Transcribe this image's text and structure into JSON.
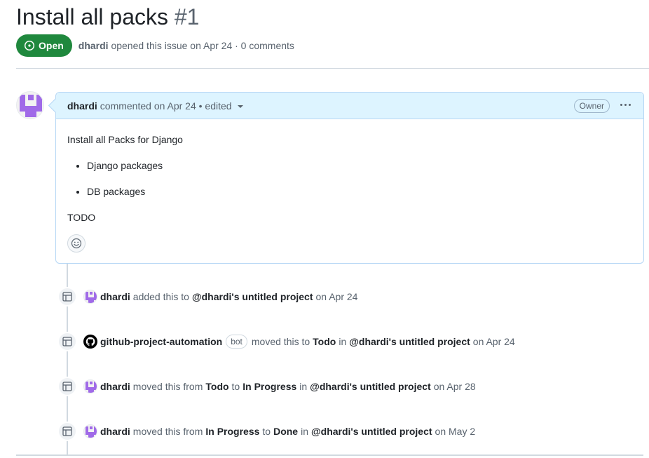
{
  "issue": {
    "title": "Install all packs",
    "number": "#1",
    "state": "Open",
    "author": "dhardi",
    "opened_text": "opened this issue on Apr 24 · 0 comments"
  },
  "comment": {
    "author": "dhardi",
    "meta": "commented on Apr 24 • edited",
    "owner_badge": "Owner",
    "intro": "Install all Packs for Django",
    "items": [
      "Django packages",
      "DB packages"
    ],
    "footer": "TODO"
  },
  "events": [
    {
      "actor": "dhardi",
      "text1": "added this to",
      "project": "@dhardi's untitled project",
      "text2": "on Apr 24"
    },
    {
      "actor": "github-project-automation",
      "bot": "bot",
      "text1": "moved this to",
      "col1": "Todo",
      "text_in": "in",
      "project": "@dhardi's untitled project",
      "text2": "on Apr 24"
    },
    {
      "actor": "dhardi",
      "text1": "moved this from",
      "col1": "Todo",
      "text_to": "to",
      "col2": "In Progress",
      "text_in": "in",
      "project": "@dhardi's untitled project",
      "text2": "on Apr 28"
    },
    {
      "actor": "dhardi",
      "text1": "moved this from",
      "col1": "In Progress",
      "text_to": "to",
      "col2": "Done",
      "text_in": "in",
      "project": "@dhardi's untitled project",
      "text2": "on May 2"
    }
  ],
  "colors": {
    "open_green": "#1f883d",
    "comment_header_bg": "#ddf4ff",
    "comment_border": "#b6d7f5",
    "avatar_purple": "#a06ae8"
  },
  "icons": {
    "state": "issue-opened-icon",
    "event": "project-table-icon",
    "reaction": "smiley-icon",
    "more": "kebab-horizontal-icon",
    "bot_avatar": "github-mark-icon"
  }
}
